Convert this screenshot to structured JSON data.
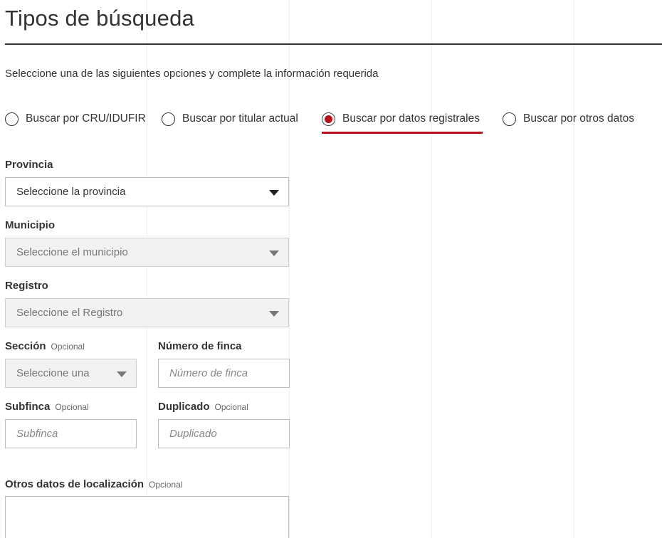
{
  "page": {
    "title": "Tipos de búsqueda",
    "intro": "Seleccione una de las siguientes opciones y complete la información requerida"
  },
  "search_types": [
    {
      "label": "Buscar por CRU/IDUFIR",
      "selected": false
    },
    {
      "label": "Buscar por titular actual",
      "selected": false
    },
    {
      "label": "Buscar por datos registrales",
      "selected": true
    },
    {
      "label": "Buscar por otros datos",
      "selected": false
    }
  ],
  "form": {
    "provincia": {
      "label": "Provincia",
      "value": "Seleccione la provincia",
      "disabled": false
    },
    "municipio": {
      "label": "Municipio",
      "value": "Seleccione el municipio",
      "disabled": true
    },
    "registro": {
      "label": "Registro",
      "value": "Seleccione el Registro",
      "disabled": true
    },
    "seccion": {
      "label": "Sección",
      "optional": "Opcional",
      "value": "Seleccione una",
      "disabled": true
    },
    "numero_finca": {
      "label": "Número de finca",
      "placeholder": "Número de finca",
      "value": ""
    },
    "subfinca": {
      "label": "Subfinca",
      "optional": "Opcional",
      "placeholder": "Subfinca",
      "value": ""
    },
    "duplicado": {
      "label": "Duplicado",
      "optional": "Opcional",
      "placeholder": "Duplicado",
      "value": ""
    },
    "otros_datos": {
      "label": "Otros datos de localización",
      "optional": "Opcional",
      "value": ""
    }
  },
  "colors": {
    "accent": "#b5121b",
    "text": "#333333",
    "disabled_bg": "#f2f2f2",
    "border": "#bdbdbd"
  }
}
